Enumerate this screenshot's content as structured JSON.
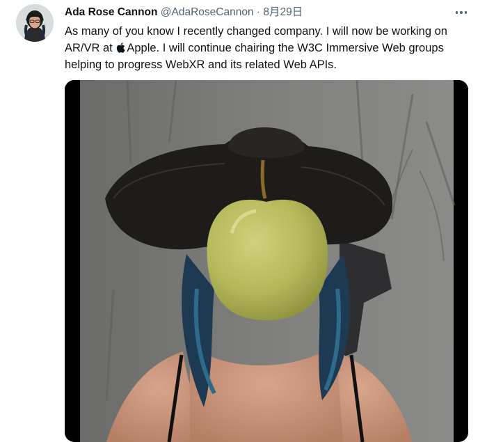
{
  "tweet": {
    "author_name": "Ada Rose Cannon",
    "author_handle": "@AdaRoseCannon",
    "separator": "·",
    "date": "8月29日",
    "text_part1": "As many of you know I recently changed company. I will now be working on AR/VR at ",
    "text_part2": "Apple. I will continue chairing the W3C Immersive Web groups helping to progress WebXR and its related Web APIs.",
    "more_icon": "ellipsis-icon",
    "inline_logo": "apple-logo-icon",
    "media_description_icon": "photo"
  },
  "colors": {
    "text_primary": "#0f1419",
    "text_secondary": "#536471",
    "background": "#ffffff"
  }
}
